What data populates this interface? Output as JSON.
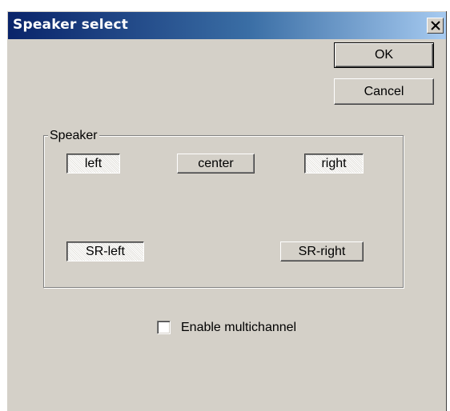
{
  "window": {
    "title": "Speaker select"
  },
  "titlebar": {
    "close_icon": "close-icon"
  },
  "buttons": {
    "ok_label": "OK",
    "cancel_label": "Cancel"
  },
  "speaker_group": {
    "legend": "Speaker",
    "speakers": [
      {
        "label": "left",
        "checked": true
      },
      {
        "label": "center",
        "checked": false
      },
      {
        "label": "right",
        "checked": true
      },
      {
        "label": "SR-left",
        "checked": true
      },
      {
        "label": "SR-right",
        "checked": false
      }
    ]
  },
  "multichannel": {
    "label": "Enable multichannel",
    "checked": false
  },
  "colors": {
    "dialog_face": "#d4d0c8",
    "title_active_start": "#0a246a",
    "title_active_end": "#a6caf0"
  }
}
